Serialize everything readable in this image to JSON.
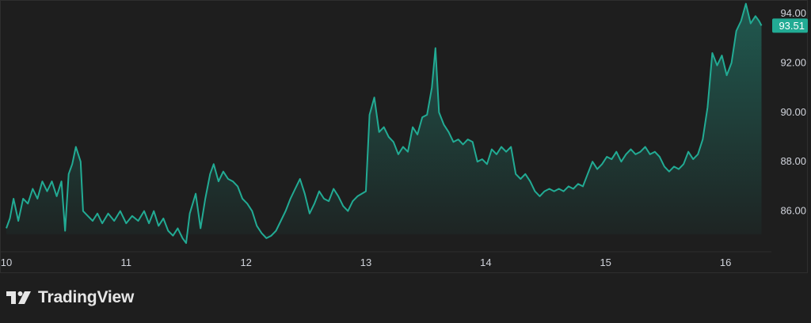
{
  "brand": {
    "name": "TradingView",
    "icon": "tradingview-logo-icon"
  },
  "colors": {
    "background": "#1e1e1e",
    "line": "#22ab94",
    "price_tag": "#22ab94",
    "text": "#d1d4dc"
  },
  "chart_data": {
    "type": "area",
    "title": "",
    "xlabel": "",
    "ylabel": "",
    "x_ticks": [
      "10",
      "11",
      "12",
      "13",
      "14",
      "15",
      "16"
    ],
    "y_ticks": [
      "86.00",
      "88.00",
      "90.00",
      "92.00",
      "94.00"
    ],
    "xlim": [
      10,
      16.33
    ],
    "ylim": [
      84.35,
      94.55
    ],
    "grid": false,
    "y_axis_side": "right",
    "last_price": "93.51",
    "series": [
      {
        "values": [
          [
            10.0,
            85.3
          ],
          [
            10.03,
            85.7
          ],
          [
            10.06,
            86.5
          ],
          [
            10.1,
            85.6
          ],
          [
            10.14,
            86.5
          ],
          [
            10.18,
            86.3
          ],
          [
            10.22,
            86.9
          ],
          [
            10.26,
            86.5
          ],
          [
            10.3,
            87.2
          ],
          [
            10.34,
            86.8
          ],
          [
            10.38,
            87.2
          ],
          [
            10.42,
            86.6
          ],
          [
            10.46,
            87.2
          ],
          [
            10.49,
            85.2
          ],
          [
            10.52,
            87.5
          ],
          [
            10.55,
            87.9
          ],
          [
            10.58,
            88.6
          ],
          [
            10.62,
            88.0
          ],
          [
            10.64,
            86.0
          ],
          [
            10.68,
            85.8
          ],
          [
            10.72,
            85.6
          ],
          [
            10.76,
            85.9
          ],
          [
            10.8,
            85.5
          ],
          [
            10.85,
            85.9
          ],
          [
            10.9,
            85.6
          ],
          [
            10.95,
            86.0
          ],
          [
            11.0,
            85.5
          ],
          [
            11.05,
            85.8
          ],
          [
            11.1,
            85.6
          ],
          [
            11.15,
            86.0
          ],
          [
            11.19,
            85.5
          ],
          [
            11.23,
            86.0
          ],
          [
            11.27,
            85.4
          ],
          [
            11.31,
            85.7
          ],
          [
            11.35,
            85.2
          ],
          [
            11.39,
            85.0
          ],
          [
            11.43,
            85.3
          ],
          [
            11.47,
            84.9
          ],
          [
            11.5,
            84.7
          ],
          [
            11.53,
            85.9
          ],
          [
            11.58,
            86.7
          ],
          [
            11.62,
            85.3
          ],
          [
            11.66,
            86.5
          ],
          [
            11.7,
            87.5
          ],
          [
            11.73,
            87.9
          ],
          [
            11.77,
            87.2
          ],
          [
            11.81,
            87.6
          ],
          [
            11.85,
            87.3
          ],
          [
            11.89,
            87.2
          ],
          [
            11.93,
            87.0
          ],
          [
            11.97,
            86.5
          ],
          [
            12.01,
            86.3
          ],
          [
            12.05,
            86.0
          ],
          [
            12.09,
            85.4
          ],
          [
            12.13,
            85.1
          ],
          [
            12.17,
            84.9
          ],
          [
            12.21,
            85.0
          ],
          [
            12.25,
            85.2
          ],
          [
            12.29,
            85.6
          ],
          [
            12.33,
            86.0
          ],
          [
            12.37,
            86.5
          ],
          [
            12.41,
            86.9
          ],
          [
            12.45,
            87.3
          ],
          [
            12.49,
            86.7
          ],
          [
            12.53,
            85.9
          ],
          [
            12.57,
            86.3
          ],
          [
            12.61,
            86.8
          ],
          [
            12.65,
            86.5
          ],
          [
            12.69,
            86.4
          ],
          [
            12.73,
            86.9
          ],
          [
            12.77,
            86.6
          ],
          [
            12.81,
            86.2
          ],
          [
            12.85,
            86.0
          ],
          [
            12.89,
            86.4
          ],
          [
            12.93,
            86.6
          ],
          [
            13.0,
            86.8
          ],
          [
            13.03,
            89.9
          ],
          [
            13.07,
            90.6
          ],
          [
            13.11,
            89.2
          ],
          [
            13.15,
            89.4
          ],
          [
            13.19,
            89.0
          ],
          [
            13.23,
            88.8
          ],
          [
            13.27,
            88.3
          ],
          [
            13.31,
            88.6
          ],
          [
            13.35,
            88.4
          ],
          [
            13.39,
            89.4
          ],
          [
            13.43,
            89.1
          ],
          [
            13.47,
            89.8
          ],
          [
            13.51,
            89.9
          ],
          [
            13.55,
            91.0
          ],
          [
            13.58,
            92.6
          ],
          [
            13.61,
            90.0
          ],
          [
            13.65,
            89.5
          ],
          [
            13.69,
            89.2
          ],
          [
            13.73,
            88.8
          ],
          [
            13.77,
            88.9
          ],
          [
            13.81,
            88.7
          ],
          [
            13.85,
            88.9
          ],
          [
            13.89,
            88.8
          ],
          [
            13.93,
            88.0
          ],
          [
            13.97,
            88.1
          ],
          [
            14.01,
            87.9
          ],
          [
            14.05,
            88.5
          ],
          [
            14.09,
            88.3
          ],
          [
            14.13,
            88.6
          ],
          [
            14.17,
            88.4
          ],
          [
            14.21,
            88.6
          ],
          [
            14.25,
            87.5
          ],
          [
            14.29,
            87.3
          ],
          [
            14.33,
            87.5
          ],
          [
            14.37,
            87.2
          ],
          [
            14.41,
            86.8
          ],
          [
            14.45,
            86.6
          ],
          [
            14.49,
            86.8
          ],
          [
            14.53,
            86.9
          ],
          [
            14.57,
            86.8
          ],
          [
            14.61,
            86.9
          ],
          [
            14.65,
            86.8
          ],
          [
            14.69,
            87.0
          ],
          [
            14.73,
            86.9
          ],
          [
            14.77,
            87.1
          ],
          [
            14.81,
            87.0
          ],
          [
            14.85,
            87.5
          ],
          [
            14.89,
            88.0
          ],
          [
            14.93,
            87.7
          ],
          [
            14.97,
            87.9
          ],
          [
            15.01,
            88.2
          ],
          [
            15.05,
            88.1
          ],
          [
            15.09,
            88.4
          ],
          [
            15.13,
            88.0
          ],
          [
            15.17,
            88.3
          ],
          [
            15.21,
            88.5
          ],
          [
            15.25,
            88.3
          ],
          [
            15.29,
            88.4
          ],
          [
            15.33,
            88.6
          ],
          [
            15.37,
            88.3
          ],
          [
            15.41,
            88.4
          ],
          [
            15.45,
            88.2
          ],
          [
            15.49,
            87.8
          ],
          [
            15.53,
            87.6
          ],
          [
            15.57,
            87.8
          ],
          [
            15.61,
            87.7
          ],
          [
            15.65,
            87.9
          ],
          [
            15.69,
            88.4
          ],
          [
            15.73,
            88.1
          ],
          [
            15.77,
            88.3
          ],
          [
            15.81,
            88.9
          ],
          [
            15.85,
            90.2
          ],
          [
            15.89,
            92.4
          ],
          [
            15.93,
            91.9
          ],
          [
            15.97,
            92.3
          ],
          [
            16.01,
            91.5
          ],
          [
            16.05,
            92.0
          ],
          [
            16.09,
            93.3
          ],
          [
            16.13,
            93.7
          ],
          [
            16.17,
            94.4
          ],
          [
            16.21,
            93.6
          ],
          [
            16.25,
            93.9
          ],
          [
            16.28,
            93.7
          ],
          [
            16.3,
            93.51
          ]
        ]
      }
    ]
  }
}
